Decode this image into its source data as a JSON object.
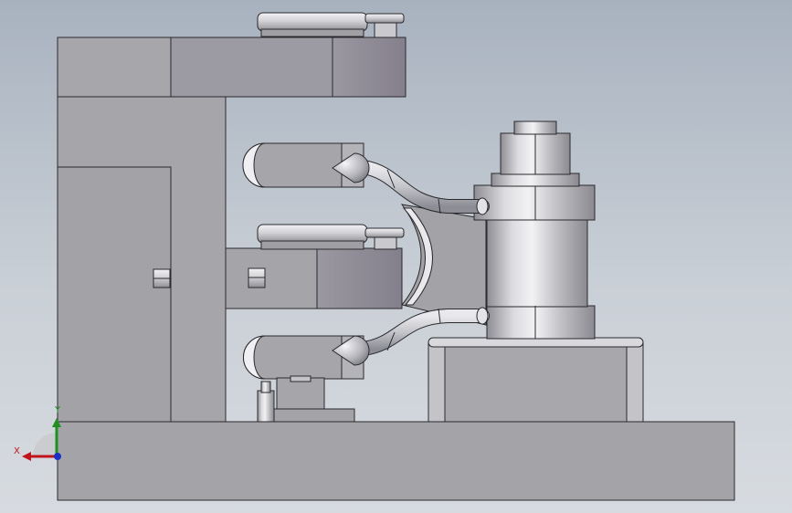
{
  "viewport": {
    "background_top": "#a8b2bf",
    "background_bottom": "#d7dbe0"
  },
  "colors": {
    "body_face": "#a5a5a9",
    "body_side": "#8f8e95",
    "edge": "#2a2a2e",
    "metal_light": "#e8e8ec",
    "metal_mid": "#b9b9be",
    "metal_dark": "#7c7c84",
    "hose": "#bfc0c6",
    "axis_x": "#c0141b",
    "axis_y": "#1f8f22",
    "axis_z": "#1730c8"
  },
  "triad": {
    "x_label": "X",
    "y_label": "Y"
  }
}
